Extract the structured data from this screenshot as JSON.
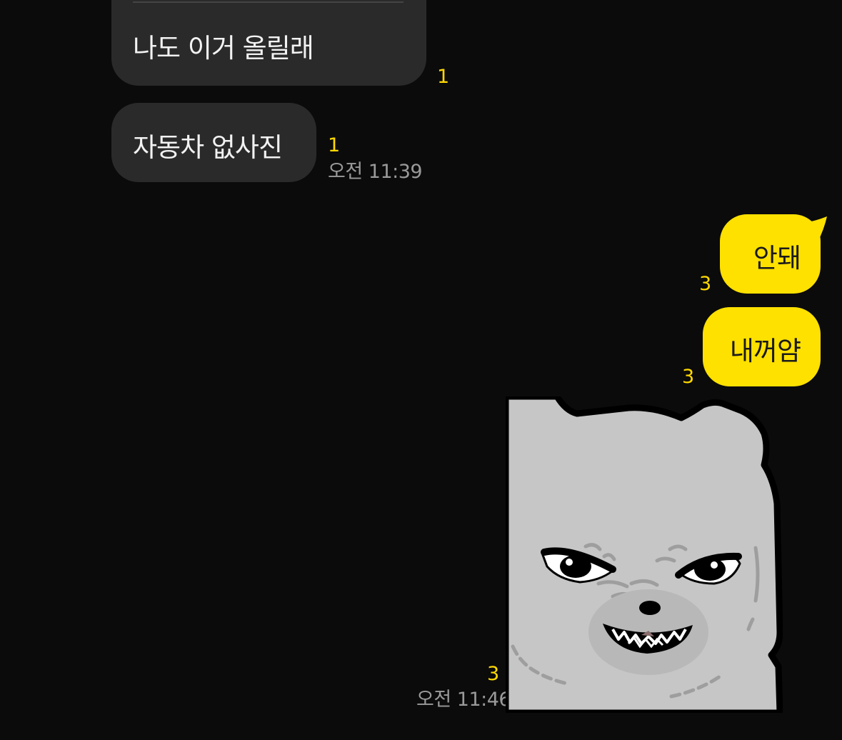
{
  "chat": {
    "messages": [
      {
        "sender": "other",
        "text": "나도 이거 올릴래",
        "unread": "1"
      },
      {
        "sender": "other",
        "text": "자동차 없사진",
        "unread": "1",
        "time": "오전 11:39"
      },
      {
        "sender": "me",
        "text": "안돼",
        "unread": "3"
      },
      {
        "sender": "me",
        "text": "내꺼얌",
        "unread": "3"
      },
      {
        "sender": "me",
        "sticker": "angry-bear-sticker",
        "unread": "3",
        "time": "오전 11:46"
      }
    ]
  },
  "colors": {
    "background": "#0b0b0b",
    "incoming_bubble": "#2a2a2a",
    "outgoing_bubble": "#ffe100",
    "unread_count": "#ffd900",
    "timestamp": "#9a9a9a"
  }
}
